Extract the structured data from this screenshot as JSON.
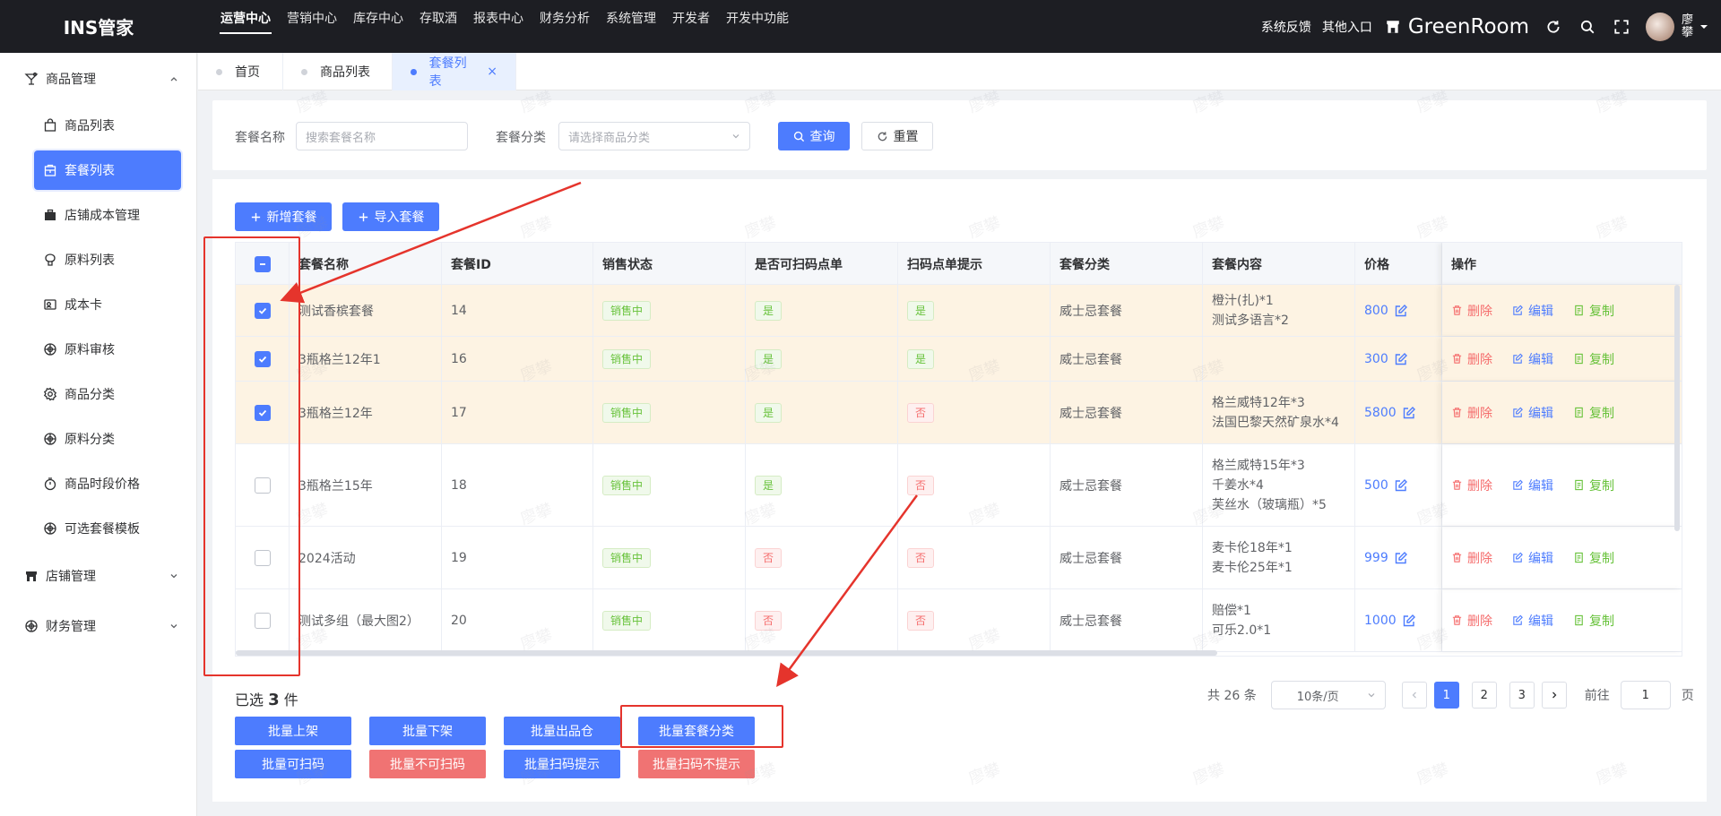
{
  "app": {
    "brand": "INS管家",
    "top_nav": [
      "运营中心",
      "营销中心",
      "库存中心",
      "存取酒",
      "报表中心",
      "财务分析",
      "系统管理",
      "开发者",
      "开发中功能"
    ],
    "top_links": [
      "系统反馈",
      "其他入口"
    ],
    "store_name": "GreenRoom",
    "user_name": "廖攀"
  },
  "sidebar": {
    "groups": [
      {
        "label": "商品管理",
        "expanded": true
      },
      {
        "label": "店铺管理",
        "expanded": false
      },
      {
        "label": "财务管理",
        "expanded": false
      }
    ],
    "items": [
      {
        "label": "商品列表",
        "icon": "bag-icon"
      },
      {
        "label": "套餐列表",
        "icon": "package-icon",
        "active": true
      },
      {
        "label": "店铺成本管理",
        "icon": "briefcase-icon"
      },
      {
        "label": "原料列表",
        "icon": "ingredient-icon"
      },
      {
        "label": "成本卡",
        "icon": "card-icon"
      },
      {
        "label": "原料审核",
        "icon": "review-icon"
      },
      {
        "label": "商品分类",
        "icon": "gear-icon"
      },
      {
        "label": "原料分类",
        "icon": "category-icon"
      },
      {
        "label": "商品时段价格",
        "icon": "clock-icon"
      },
      {
        "label": "可选套餐模板",
        "icon": "template-icon"
      }
    ]
  },
  "tabs": [
    {
      "label": "首页"
    },
    {
      "label": "商品列表"
    },
    {
      "label": "套餐列表",
      "active": true
    }
  ],
  "filter": {
    "name_label": "套餐名称",
    "name_placeholder": "搜索套餐名称",
    "category_label": "套餐分类",
    "category_placeholder": "请选择商品分类",
    "search_label": "查询",
    "reset_label": "重置"
  },
  "toolbar": {
    "add_label": "新增套餐",
    "import_label": "导入套餐"
  },
  "table": {
    "headers": [
      "套餐名称",
      "套餐ID",
      "销售状态",
      "是否可扫码点单",
      "扫码点单提示",
      "套餐分类",
      "套餐内容",
      "价格",
      "操作"
    ],
    "actions": {
      "delete": "删除",
      "edit": "编辑",
      "copy": "复制"
    },
    "rows": [
      {
        "name": "测试香槟套餐",
        "id": "14",
        "status": "销售中",
        "scan": "是",
        "tip": "是",
        "category": "威士忌套餐",
        "content": [
          "橙汁(扎)*1",
          "测试多语言*2"
        ],
        "price": "800",
        "selected": true
      },
      {
        "name": "3瓶格兰12年1",
        "id": "16",
        "status": "销售中",
        "scan": "是",
        "tip": "是",
        "category": "威士忌套餐",
        "content": [],
        "price": "300",
        "selected": true
      },
      {
        "name": "3瓶格兰12年",
        "id": "17",
        "status": "销售中",
        "scan": "是",
        "tip": "否",
        "category": "威士忌套餐",
        "content": [
          "格兰威特12年*3",
          "法国巴黎天然矿泉水*4"
        ],
        "price": "5800",
        "selected": true
      },
      {
        "name": "3瓶格兰15年",
        "id": "18",
        "status": "销售中",
        "scan": "是",
        "tip": "否",
        "category": "威士忌套餐",
        "content": [
          "格兰威特15年*3",
          "千姜水*4",
          "芙丝水（玻璃瓶）*5"
        ],
        "price": "500",
        "selected": false
      },
      {
        "name": "2024活动",
        "id": "19",
        "status": "销售中",
        "scan": "否",
        "tip": "否",
        "category": "威士忌套餐",
        "content": [
          "麦卡伦18年*1",
          "麦卡伦25年*1"
        ],
        "price": "999",
        "selected": false
      },
      {
        "name": "测试多组（最大图2）",
        "id": "20",
        "status": "销售中",
        "scan": "否",
        "tip": "否",
        "category": "威士忌套餐",
        "content": [
          "赔偿*1",
          "可乐2.0*1"
        ],
        "price": "1000",
        "selected": false
      }
    ]
  },
  "selection": {
    "prefix": "已选",
    "count": "3",
    "suffix": "件"
  },
  "batch_buttons": [
    "批量上架",
    "批量下架",
    "批量出品仓",
    "批量套餐分类",
    "批量可扫码",
    "批量不可扫码",
    "批量扫码提示",
    "批量扫码不提示"
  ],
  "pagination": {
    "total": "共 26 条",
    "page_size": "10条/页",
    "pages": [
      "1",
      "2",
      "3"
    ],
    "current": "1",
    "goto_prefix": "前往",
    "goto_value": "1",
    "goto_suffix": "页"
  },
  "watermark": "廖攀",
  "colors": {
    "primary": "#4d7cfe",
    "danger": "#f56c6c",
    "success": "#67c23a",
    "annotation": "#e5342c",
    "selected_row": "#fdf3e3"
  }
}
